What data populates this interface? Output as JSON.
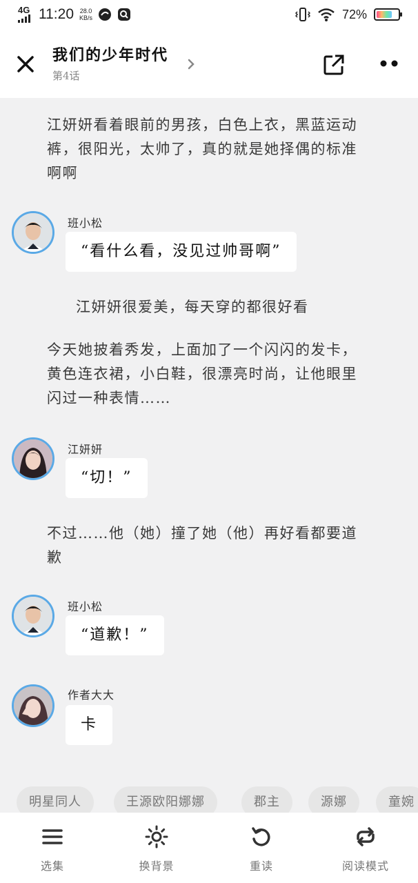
{
  "status_bar": {
    "network": "4G",
    "time": "11:20",
    "speed_value": "28.0",
    "speed_unit": "KB/s",
    "battery_percent": "72%",
    "battery_level": 0.72
  },
  "header": {
    "title": "我们的少年时代",
    "subtitle": "第4话"
  },
  "story": {
    "narration_1": "江妍妍看着眼前的男孩，白色上衣，黑蓝运动裤，很阳光，太帅了，真的就是她择偶的标准啊啊",
    "dialog_1_speaker": "班小松",
    "dialog_1_text": "“看什么看，没见过帅哥啊”",
    "narration_2": "江妍妍很爱美，每天穿的都很好看",
    "narration_3": "今天她披着秀发，上面加了一个闪闪的发卡，黄色连衣裙，小白鞋，很漂亮时尚，让他眼里闪过一种表情……",
    "dialog_2_speaker": "江妍妍",
    "dialog_2_text": "“切！”",
    "narration_4": "不过……他（她）撞了她（他）再好看都要道歉",
    "dialog_3_speaker": "班小松",
    "dialog_3_text": "“道歉！”",
    "dialog_4_speaker": "作者大大",
    "dialog_4_text": "卡"
  },
  "tags": [
    "明星同人",
    "王源欧阳娜娜",
    "郡主",
    "源娜",
    "童婉"
  ],
  "bottom_nav": {
    "episodes": "选集",
    "background": "换背景",
    "reread": "重读",
    "read_mode": "阅读模式"
  },
  "colors": {
    "avatar_ring": "#5aa9e6",
    "page_background": "#f1f1f2"
  }
}
